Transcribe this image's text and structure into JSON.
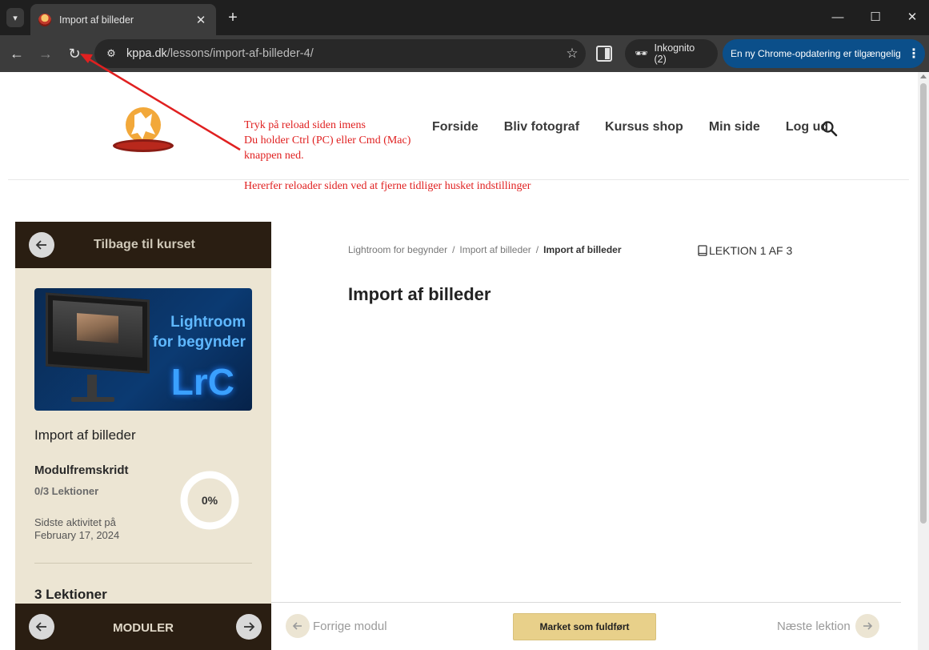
{
  "browser": {
    "tab_title": "Import af billeder",
    "url_host": "kppa.dk",
    "url_path": "/lessons/import-af-billeder-4/",
    "incognito_label": "Inkognito (2)",
    "update_label": "En ny Chrome-opdatering er tilgængelig"
  },
  "annotations": {
    "line1": "Tryk på reload siden imens",
    "line2": "Du holder Ctrl (PC) eller Cmd (Mac)",
    "line3": "knappen ned.",
    "line4": "Hererfer reloader siden ved at fjerne tidliger husket indstillinger",
    "arrow_color": "#e02020"
  },
  "nav": {
    "items": [
      "Forside",
      "Bliv fotograf",
      "Kursus shop",
      "Min side",
      "Log ud"
    ]
  },
  "sidebar": {
    "back_label": "Tilbage til kurset",
    "course_image_line1": "Lightroom",
    "course_image_line2": "for begynder",
    "course_image_logo": "LrC",
    "lesson_title": "Import af billeder",
    "progress_label": "Modulfremskridt",
    "progress_count": "0/3 Lektioner",
    "progress_percent": "0%",
    "progress_value": 0,
    "last_activity_label": "Sidste aktivitet på",
    "last_activity_date": "February 17, 2024",
    "lessons_heading": "3 Lektioner",
    "modules_label": "MODULER"
  },
  "main": {
    "breadcrumb": [
      "Lightroom for begynder",
      "Import af billeder",
      "Import af billeder"
    ],
    "lesson_counter": "LEKTION 1 AF 3",
    "title": "Import af billeder",
    "prev_module": "Forrige modul",
    "complete_button": "Market som fuldført",
    "next_lesson": "Næste lektion"
  },
  "colors": {
    "sidebar_bg": "#ece5d3",
    "sidebar_dark": "#2a1e12",
    "button_gold": "#e8d08a",
    "annotation_red": "#e02020"
  }
}
